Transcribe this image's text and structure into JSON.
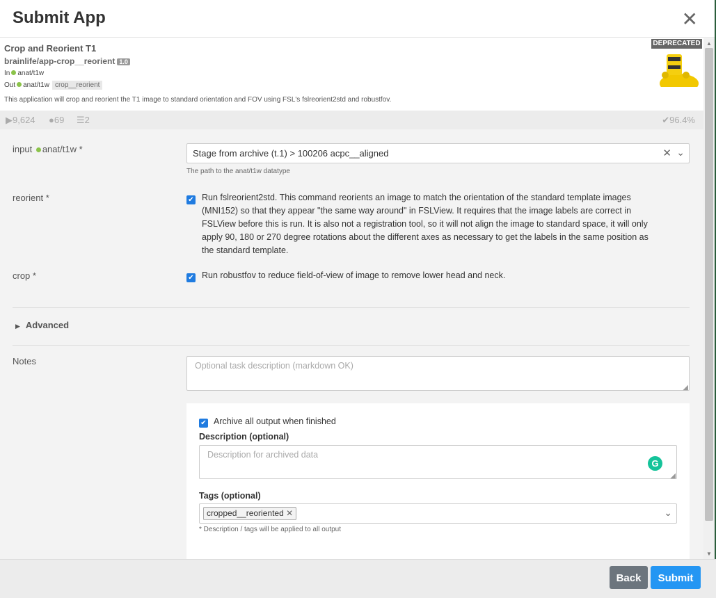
{
  "dialog": {
    "title": "Submit App",
    "close_icon": "close-icon"
  },
  "app": {
    "name": "Crop and Reorient T1",
    "repo": "brainlife/app-crop__reorient",
    "version": "1.0",
    "in_label": "In",
    "in_datatype": "anat/t1w",
    "out_label": "Out",
    "out_datatype": "anat/t1w",
    "out_tag": "crop__reorient",
    "description": "This application will crop and reorient the T1 image to standard orientation and FOV using FSL's fslreorient2std and robustfov.",
    "deprecated_label": "DEPRECATED"
  },
  "stats": {
    "runs": "9,624",
    "users": "69",
    "resources": "2",
    "success_rate": "96.4%"
  },
  "form": {
    "input_label": "input",
    "input_datatype": "anat/t1w",
    "input_required": "*",
    "input_value": "Stage from archive (t.1) > 100206 acpc__aligned",
    "input_help": "The path to the anat/t1w datatype",
    "reorient_label": "reorient *",
    "reorient_line1": "Run fslreorient2std. This command reorients an image to match the orientation of the standard template images",
    "reorient_line2": "(MNI152) so that they appear \"the same way around\" in FSLView. It requires that the image labels are correct in",
    "reorient_line3": "FSLView before this is run. It is also not a registration tool, so it will not align the image to standard space, it will only",
    "reorient_line4": "apply 90, 180 or 270 degree rotations about the different axes as necessary to get the labels in the same position as",
    "reorient_line5": "the standard template.",
    "crop_label": "crop *",
    "crop_text": "Run robustfov to reduce field-of-view of image to remove lower head and neck.",
    "advanced_label": "Advanced",
    "notes_label": "Notes",
    "notes_placeholder": "Optional task description (markdown OK)",
    "archive_label": "Archive all output when finished",
    "description_label": "Description (optional)",
    "description_placeholder": "Description for archived data",
    "tags_label": "Tags (optional)",
    "tag_value": "cropped__reoriented",
    "tags_note": "* Description / tags will be applied to all output"
  },
  "footer": {
    "back_label": "Back",
    "submit_label": "Submit"
  },
  "colors": {
    "accent": "#2496f3",
    "checkbox": "#1f7be0",
    "datatype_dot": "#8bc34a",
    "back": "#6c757d"
  }
}
